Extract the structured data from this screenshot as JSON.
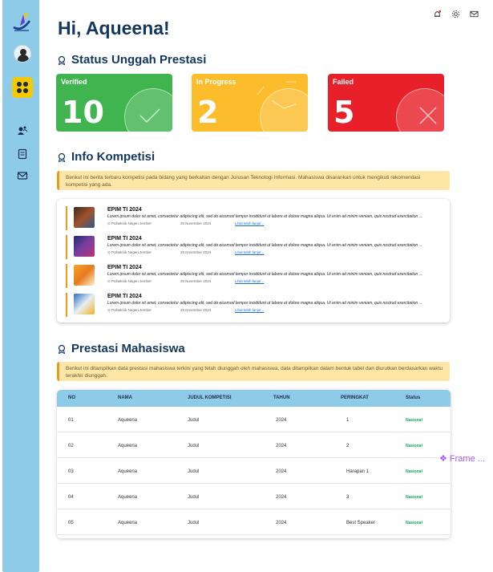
{
  "greeting": "Hi, Aqueena!",
  "sections": {
    "status_title": "Status Unggah Prestasi",
    "info_title": "Info Kompetisi",
    "prestasi_title": "Prestasi Mahasiswa"
  },
  "status_cards": [
    {
      "label": "Verified",
      "count": "10",
      "color": "#3fb44f"
    },
    {
      "label": "In Progress",
      "count": "2",
      "color": "#fbbd2c"
    },
    {
      "label": "Failed",
      "count": "5",
      "color": "#e8202a"
    }
  ],
  "info_note": "Berikut ini berita terbaru kompetisi pada bidang yang berkaitan dengan Jurusan Teknologi Informasi. Mahasiswa disarankan untuk mengikuti rekomendasi kompetisi yang ada.",
  "competitions": [
    {
      "title": "EPIM TI 2024",
      "desc": "Lorem ipsum dolor sit amet, consectetur adipiscing elit, sed do eiusmod tempor incididunt ut labore et dolore magna aliqua. Ut enim ad minim veniam, quis nostrud exercitation ...",
      "org": "Politeknik Negeri Jember",
      "date": "25 November 2024",
      "link": "Lihat lebih lanjut..."
    },
    {
      "title": "EPIM TI 2024",
      "desc": "Lorem ipsum dolor sit amet, consectetur adipiscing elit, sed do eiusmod tempor incididunt ut labore et dolore magna aliqua. Ut enim ad minim veniam, quis nostrud exercitation ...",
      "org": "Politeknik Negeri Jember",
      "date": "25 November 2024",
      "link": "Lihat lebih lanjut..."
    },
    {
      "title": "EPIM TI 2024",
      "desc": "Lorem ipsum dolor sit amet, consectetur adipiscing elit, sed do eiusmod tempor incididunt ut labore et dolore magna aliqua. Ut enim ad minim veniam, quis nostrud exercitation ...",
      "org": "Politeknik Negeri Jember",
      "date": "25 November 2024",
      "link": "Lihat lebih lanjut..."
    },
    {
      "title": "EPIM TI 2024",
      "desc": "Lorem ipsum dolor sit amet, consectetur adipiscing elit, sed do eiusmod tempor incididunt ut labore et dolore magna aliqua. Ut enim ad minim veniam, quis nostrud exercitation ...",
      "org": "Politeknik Negeri Jember",
      "date": "25 November 2024",
      "link": "Lihat lebih lanjut..."
    }
  ],
  "prestasi_note": "Berikut ini ditampilkan data prestasi mahasiswa terkini yang telah diunggah oleh mahasiswa, data ditampilkan dalam bentuk tabel dan diurutkan berdasarkan waktu terakhir diunggah.",
  "table": {
    "headers": [
      "NO",
      "NAMA",
      "JUDUL KOMPETISI",
      "TAHUN",
      "PERINGKAT",
      "Status"
    ],
    "rows": [
      [
        "01",
        "Aqueena",
        "Judul",
        "2024",
        "1",
        "Nasional"
      ],
      [
        "02",
        "Aqueena",
        "Judul",
        "2024",
        "2",
        "Nasional"
      ],
      [
        "03",
        "Aqueena",
        "Judul",
        "2024",
        "Harapan 1",
        "Nasional"
      ],
      [
        "04",
        "Aqueena",
        "Judul",
        "2024",
        "3",
        "Nasional"
      ],
      [
        "05",
        "Aqueena",
        "Judul",
        "2024",
        "Best Speaker",
        "Nasional"
      ]
    ]
  },
  "frame_label": "❖ Frame ...",
  "icons": {
    "top": [
      "bell-icon",
      "gear-icon",
      "mail-icon"
    ],
    "sidebar": [
      "logo",
      "avatar",
      "dashboard-icon",
      "users-icon",
      "document-icon",
      "mail-icon"
    ]
  }
}
